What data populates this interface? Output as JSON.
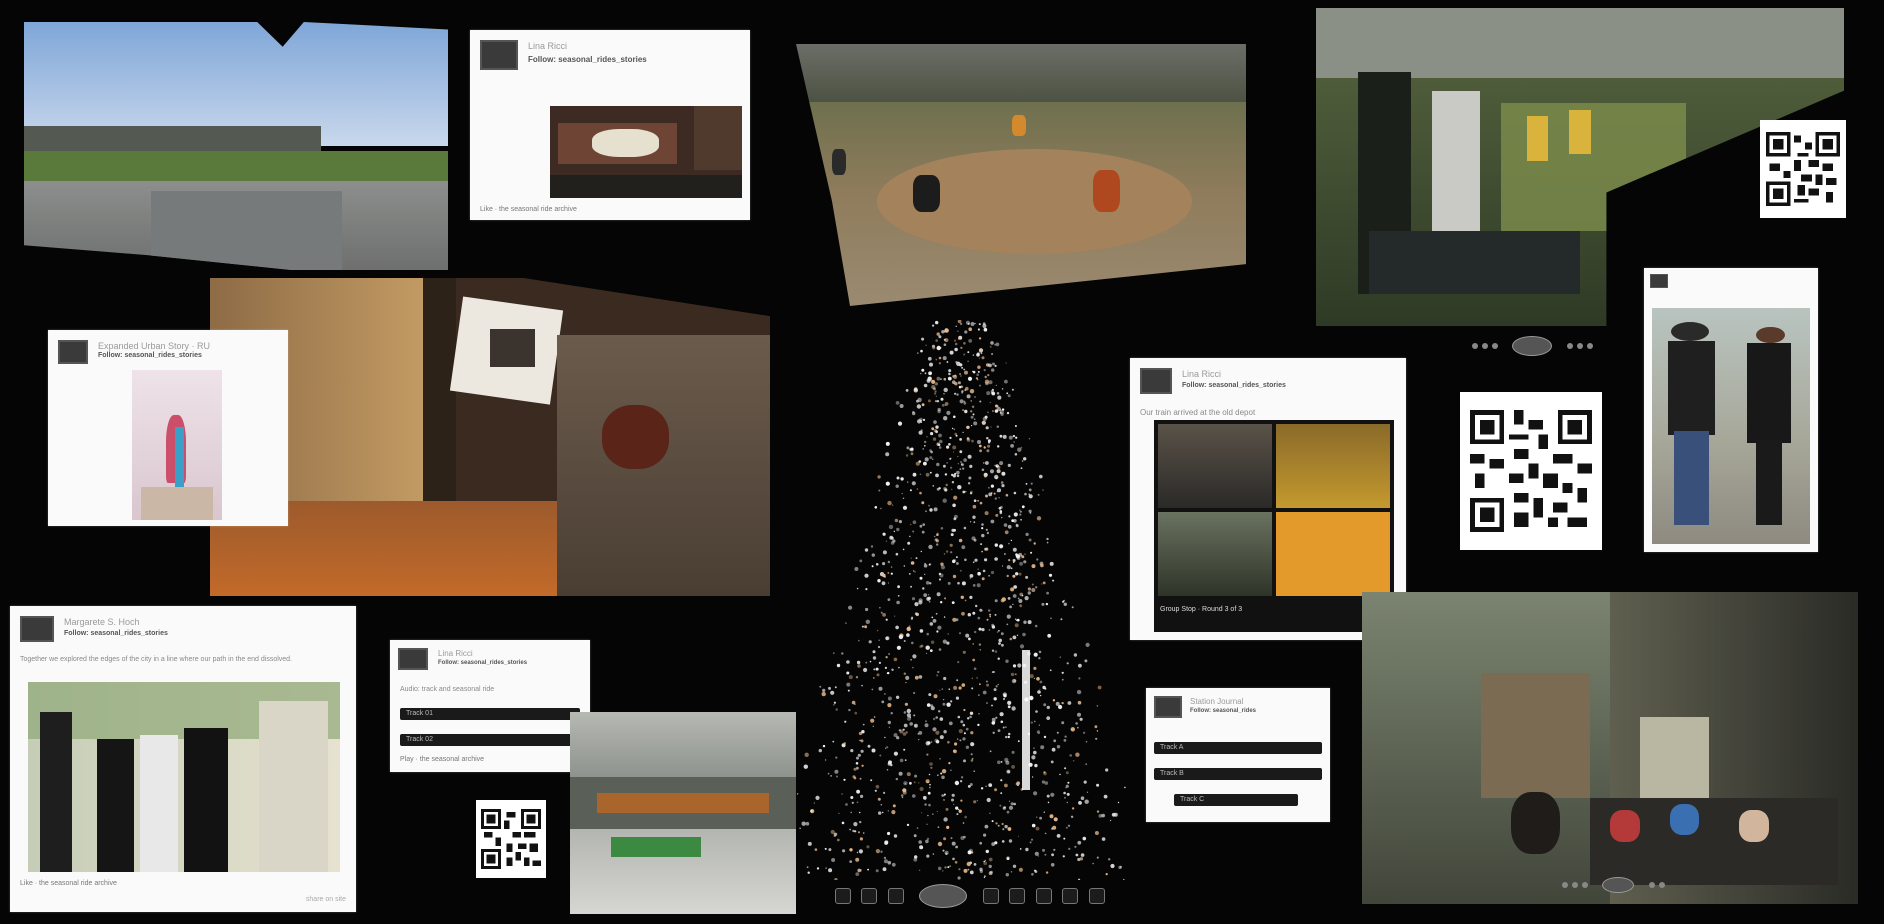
{
  "cards": {
    "top_post": {
      "name": "Lina Ricci",
      "handle": "Follow: seasonal_rides_stories",
      "footer": "Like · the seasonal ride archive"
    },
    "left_post": {
      "name": "Expanded Urban Story · RU",
      "handle": "Follow: seasonal_rides_stories"
    },
    "center_post": {
      "name": "Lina Ricci",
      "handle": "Follow: seasonal_rides_stories",
      "caption": "Our train arrived at the old depot",
      "footer": "Group Stop · Round 3 of 3"
    },
    "bottom_left_post": {
      "name": "Margarete S. Hoch",
      "handle": "Follow: seasonal_rides_stories",
      "body": "Together we explored the edges of the city in a line where our path in the end dissolved.",
      "footer": "Like · the seasonal ride archive",
      "corner": "share on site"
    },
    "bottom_mid_post": {
      "name": "Lina Ricci",
      "handle": "Follow: seasonal_rides_stories",
      "caption": "Audio: track and seasonal ride",
      "track1": "Track 01",
      "track2": "Track 02",
      "footer": "Play · the seasonal archive"
    },
    "bottom_right_post": {
      "name": "Station Journal",
      "handle": "Follow: seasonal_rides",
      "track1": "Track A",
      "track2": "Track B",
      "track3": "Track C"
    }
  },
  "viewer": {
    "label": "point cloud viewer"
  },
  "colors": {
    "background": "#050505",
    "card": "#fafafa",
    "bar": "#1a1a1a"
  },
  "icons": [
    "qr-code",
    "avatar",
    "prev-icon",
    "next-icon",
    "zoom-icon",
    "view-hub-icon"
  ]
}
